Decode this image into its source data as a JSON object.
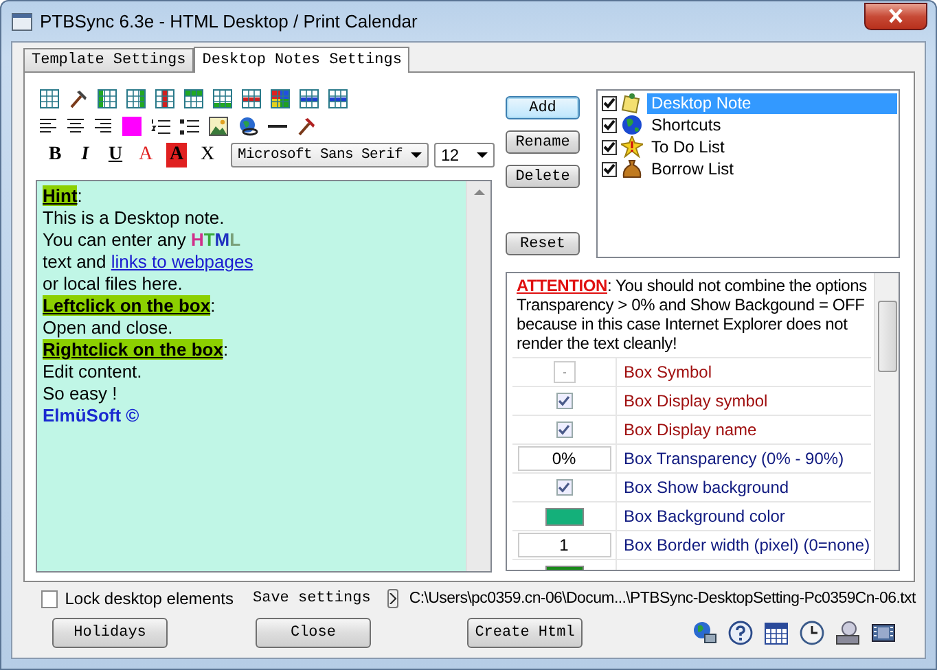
{
  "window": {
    "title": "PTBSync 6.3e - HTML Desktop / Print Calendar"
  },
  "tabs": [
    {
      "label": "Template Settings",
      "selected": false
    },
    {
      "label": "Desktop Notes Settings",
      "selected": true
    }
  ],
  "format_buttons": [
    {
      "kind": "bold",
      "label": "B"
    },
    {
      "kind": "italic",
      "label": "I"
    },
    {
      "kind": "underline",
      "label": "U"
    },
    {
      "kind": "font_color",
      "label": "A"
    },
    {
      "kind": "back_color",
      "label": "A"
    },
    {
      "kind": "clear",
      "label": "X"
    }
  ],
  "font": {
    "value": "Microsoft Sans Serif"
  },
  "font_size": {
    "value": "12"
  },
  "editor": {
    "lines": [
      [
        {
          "kind": "heading",
          "text": "Hint"
        },
        {
          "kind": "plain",
          "text": ":"
        }
      ],
      [
        {
          "kind": "plain",
          "text": "This is a Desktop note."
        }
      ],
      [
        {
          "kind": "plain",
          "text": "You can enter any "
        },
        {
          "kind": "letter",
          "text": "H",
          "color": "#d0308a"
        },
        {
          "kind": "letter",
          "text": "T",
          "color": "#3aa83a"
        },
        {
          "kind": "letter",
          "text": "M",
          "color": "#2030c0"
        },
        {
          "kind": "letter",
          "text": "L",
          "color": "#7aa07a"
        }
      ],
      [
        {
          "kind": "plain",
          "text": "text and "
        },
        {
          "kind": "link",
          "text": "links to webpages"
        }
      ],
      [
        {
          "kind": "plain",
          "text": "or local files here."
        }
      ],
      [
        {
          "kind": "heading",
          "text": "Leftclick on the box"
        },
        {
          "kind": "plain",
          "text": ":"
        }
      ],
      [
        {
          "kind": "plain",
          "text": "Open and close."
        }
      ],
      [
        {
          "kind": "heading",
          "text": "Rightclick on the box"
        },
        {
          "kind": "plain",
          "text": ":"
        }
      ],
      [
        {
          "kind": "plain",
          "text": "Edit content."
        }
      ],
      [
        {
          "kind": "plain",
          "text": "So easy !"
        }
      ],
      [
        {
          "kind": "brand",
          "text": "ElmüSoft ©"
        }
      ]
    ]
  },
  "note_buttons": [
    {
      "label": "Add",
      "focused": true
    },
    {
      "label": "Rename",
      "focused": false
    },
    {
      "label": "Delete",
      "focused": false
    }
  ],
  "reset_button": "Reset",
  "notes": [
    {
      "kind": "note",
      "label": "Desktop Note",
      "checked": true,
      "selected": true
    },
    {
      "kind": "globe",
      "label": "Shortcuts",
      "checked": true,
      "selected": false
    },
    {
      "kind": "star",
      "label": "To Do List",
      "checked": true,
      "selected": false
    },
    {
      "kind": "bag",
      "label": "Borrow List",
      "checked": true,
      "selected": false
    }
  ],
  "properties": {
    "attention": {
      "label": "ATTENTION",
      "text": ": You should not combine the options Transparency > 0% and Show Backgound = OFF because in this case Internet Explorer does not render the text cleanly!"
    },
    "rows": [
      {
        "kind": "symbol",
        "color": "#a01010",
        "label": "Box Symbol"
      },
      {
        "kind": "checkbox",
        "checked": true,
        "color": "#a01010",
        "label": "Box Display symbol"
      },
      {
        "kind": "checkbox",
        "checked": true,
        "color": "#a01010",
        "label": "Box Display name"
      },
      {
        "kind": "value",
        "value": "0%",
        "color": "#101a80",
        "label": "Box Transparency (0% - 90%)"
      },
      {
        "kind": "checkbox",
        "checked": true,
        "color": "#101a80",
        "label": "Box Show background"
      },
      {
        "kind": "color",
        "swatch": {
          "color": "#14b07a"
        },
        "color": "#101a80",
        "label": "Box Background color"
      },
      {
        "kind": "value",
        "value": "1",
        "color": "#101a80",
        "label": "Box Border width (pixel) (0=none)"
      },
      {
        "kind": "color",
        "swatch": {
          "color": "#1a8a1a"
        }
      }
    ]
  },
  "footer": {
    "lock": {
      "label": "Lock desktop elements",
      "checked": false
    },
    "save_label": "Save settings",
    "path": "C:\\Users\\pc0359.cn-06\\Docum...\\PTBSync-DesktopSetting-Pc0359Cn-06.txt",
    "buttons": [
      "Holidays",
      "Close",
      "Create Html"
    ]
  }
}
